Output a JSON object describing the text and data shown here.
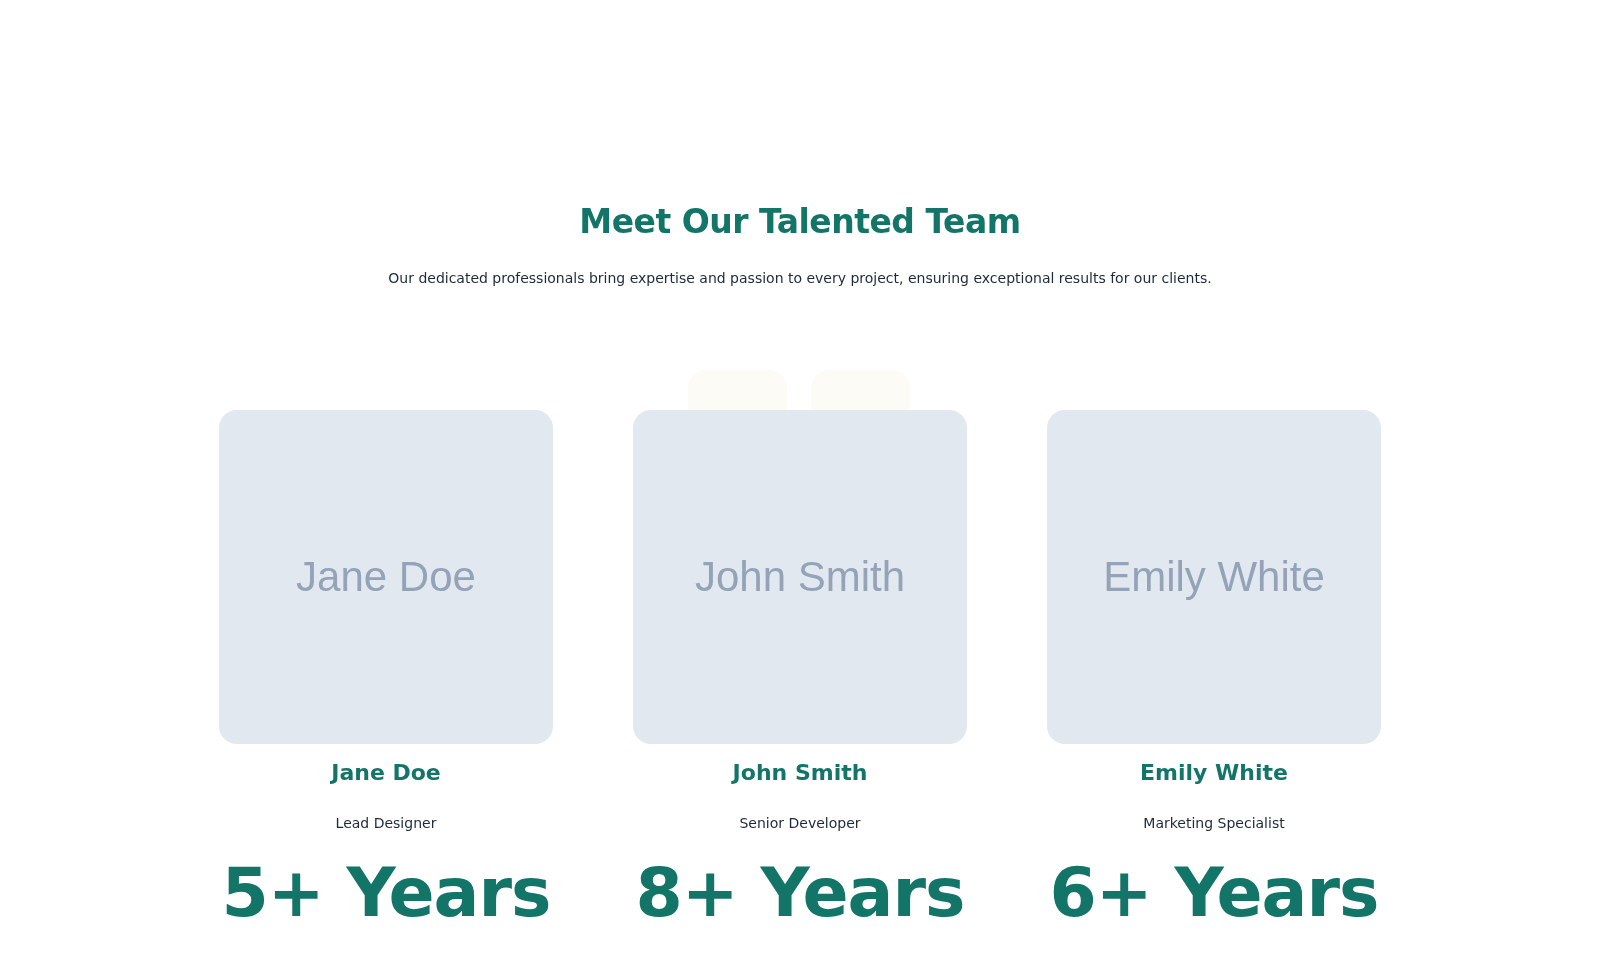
{
  "section": {
    "title": "Meet Our Talented Team",
    "subtitle": "Our dedicated professionals bring expertise and passion to every project, ensuring exceptional results for our clients."
  },
  "members": [
    {
      "photo_label": "Jane Doe",
      "name": "Jane Doe",
      "role": "Lead Designer",
      "experience": "5+ Years"
    },
    {
      "photo_label": "John Smith",
      "name": "John Smith",
      "role": "Senior Developer",
      "experience": "8+ Years"
    },
    {
      "photo_label": "Emily White",
      "name": "Emily White",
      "role": "Marketing Specialist",
      "experience": "6+ Years"
    }
  ]
}
